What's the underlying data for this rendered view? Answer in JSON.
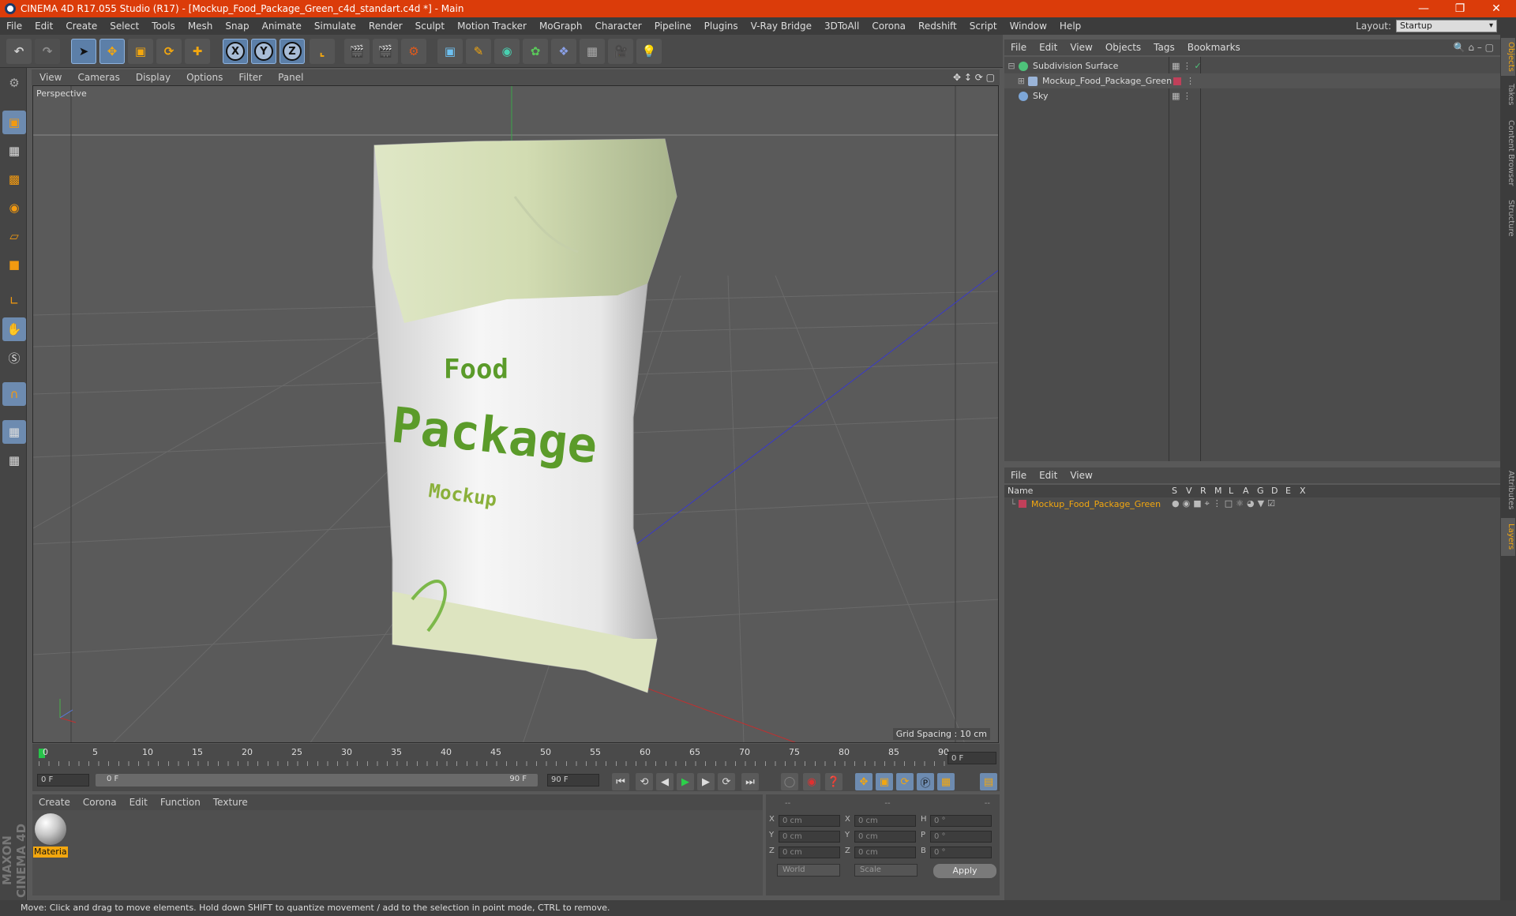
{
  "app": {
    "title": "CINEMA 4D R17.055 Studio (R17) - [Mockup_Food_Package_Green_c4d_standart.c4d *] - Main"
  },
  "menu": [
    "File",
    "Edit",
    "Create",
    "Select",
    "Tools",
    "Mesh",
    "Snap",
    "Animate",
    "Simulate",
    "Render",
    "Sculpt",
    "Motion Tracker",
    "MoGraph",
    "Character",
    "Pipeline",
    "Plugins",
    "V-Ray Bridge",
    "3DToAll",
    "Corona",
    "Redshift",
    "Script",
    "Window",
    "Help"
  ],
  "layout": {
    "label": "Layout:",
    "value": "Startup"
  },
  "toolbar": {
    "x": "X",
    "y": "Y",
    "z": "Z"
  },
  "viewport": {
    "menu": [
      "View",
      "Cameras",
      "Display",
      "Options",
      "Filter",
      "Panel"
    ],
    "label": "Perspective",
    "grid_spacing": "Grid Spacing : 10 cm",
    "package_text": {
      "line1": "Food",
      "line2": "Package",
      "line3": "Mockup"
    }
  },
  "timeline": {
    "ticks": [
      "0",
      "5",
      "10",
      "15",
      "20",
      "25",
      "30",
      "35",
      "40",
      "45",
      "50",
      "55",
      "60",
      "65",
      "70",
      "75",
      "80",
      "85",
      "90"
    ],
    "current_frame": "0 F",
    "start_field": "0 F",
    "range_start": "0 F",
    "range_end": "90 F",
    "end_field": "90 F",
    "progress": 0
  },
  "material_manager": {
    "menu": [
      "Create",
      "Corona",
      "Edit",
      "Function",
      "Texture"
    ],
    "material_name": "Materia"
  },
  "coordinates": {
    "header": [
      "--",
      "--",
      "--"
    ],
    "rows": [
      {
        "a": "X",
        "av": "0 cm",
        "b": "X",
        "bv": "0 cm",
        "c": "H",
        "cv": "0 °"
      },
      {
        "a": "Y",
        "av": "0 cm",
        "b": "Y",
        "bv": "0 cm",
        "c": "P",
        "cv": "0 °"
      },
      {
        "a": "Z",
        "av": "0 cm",
        "b": "Z",
        "bv": "0 cm",
        "c": "B",
        "cv": "0 °"
      }
    ],
    "world": "World",
    "scale": "Scale",
    "apply": "Apply"
  },
  "object_manager": {
    "menu": [
      "File",
      "Edit",
      "View",
      "Objects",
      "Tags",
      "Bookmarks"
    ],
    "objects": [
      {
        "name": "Subdivision Surface",
        "icon_color": "#4ec27a"
      },
      {
        "name": "Mockup_Food_Package_Green",
        "icon_color": "#9ab4d8"
      },
      {
        "name": "Sky",
        "icon_color": "#7da7d8"
      }
    ]
  },
  "layer_manager": {
    "menu": [
      "File",
      "Edit",
      "View"
    ],
    "columns": {
      "name": "Name",
      "flags": [
        "S",
        "V",
        "R",
        "M",
        "L",
        "A",
        "G",
        "D",
        "E",
        "X"
      ]
    },
    "layers": [
      {
        "name": "Mockup_Food_Package_Green",
        "color": "#c0405a"
      }
    ]
  },
  "right_tabs": [
    "Objects",
    "Takes",
    "Content Browser",
    "Structure",
    "Attributes",
    "Layers"
  ],
  "status": "Move: Click and drag to move elements. Hold down SHIFT to quantize movement / add to the selection in point mode, CTRL to remove.",
  "brand": "MAXON CINEMA 4D",
  "colors": {
    "title_bar": "#db3c0a",
    "accent": "#f3a70f",
    "package_green": "#5b9b2a"
  }
}
